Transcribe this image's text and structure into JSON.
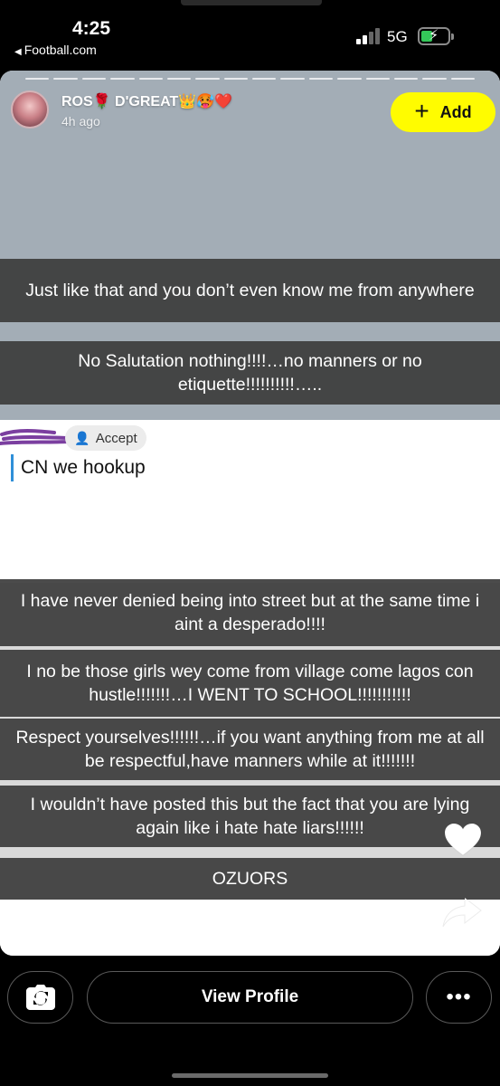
{
  "status_bar": {
    "time": "4:25",
    "back_app": "Football.com",
    "network": "5G",
    "back_arrow_glyph": "◀",
    "bolt_glyph": "⚡",
    "signal_icon": "signal-bars-icon",
    "battery_icon": "battery-charging-icon"
  },
  "story": {
    "username": "ROS🌹 D'GREAT👑🥵❤️",
    "posted_ago": "4h ago",
    "add_label": "Add",
    "add_plus_glyph": "+",
    "add_color": "#fffc00",
    "background_color": "#a3adb6",
    "captions": [
      "Just like that and you don’t even know me from anywhere",
      "No Salutation nothing!!!!…no manners or no etiquette!!!!!!!!!!…..",
      "I have never denied being into street but at the same time i aint a desperado!!!!",
      "I no be those girls wey come from village come lagos con hustle!!!!!!!…I WENT TO SCHOOL!!!!!!!!!!!",
      "Respect yourselves!!!!!!…if you want anything from me at all be respectful,have manners while at it!!!!!!!",
      "I wouldn’t have posted this but the fact that you are lying again like i hate hate liars!!!!!!",
      "OZUORS"
    ],
    "screenshot": {
      "accept_label": "Accept",
      "accept_icon_glyph": "👤",
      "message": "CN we hookup",
      "message_bar_color": "#2f8fd8",
      "scribble_color": "#7b3fa0"
    }
  },
  "bottom_bar": {
    "view_profile_label": "View Profile",
    "more_glyph": "•••",
    "camera_icon": "camera-flip-icon"
  },
  "icons": {
    "heart": "heart-icon",
    "share": "share-icon"
  }
}
